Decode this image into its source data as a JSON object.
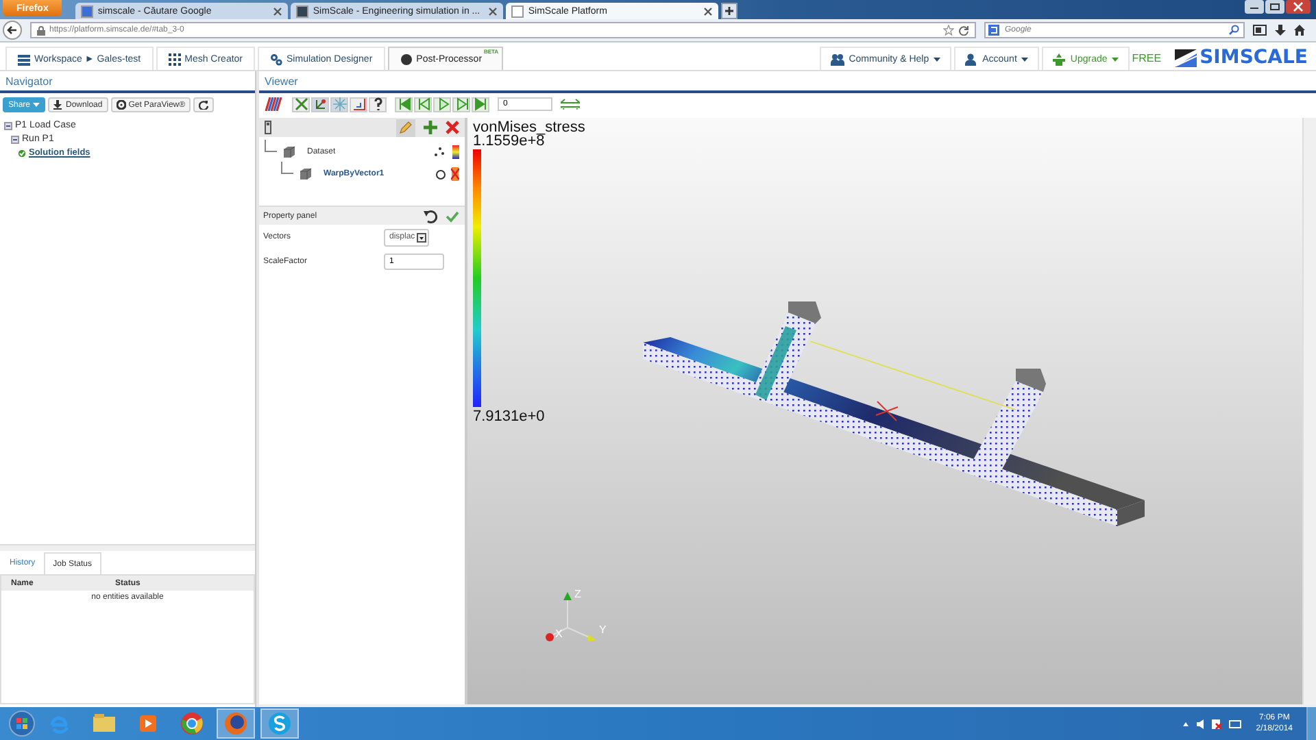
{
  "browser": {
    "menu_button": "Firefox",
    "tabs": [
      {
        "title": "simscale - Căutare Google",
        "selected": false
      },
      {
        "title": "SimScale - Engineering simulation in ...",
        "selected": false
      },
      {
        "title": "SimScale Platform",
        "selected": true
      }
    ],
    "url": "https://platform.simscale.de/#tab_3-0",
    "search_placeholder": "Google"
  },
  "app_nav": {
    "items": [
      {
        "label": "Workspace ► Gales-test",
        "selected": false
      },
      {
        "label": "Mesh Creator",
        "selected": false
      },
      {
        "label": "Simulation Designer",
        "selected": false
      },
      {
        "label": "Post-Processor",
        "badge": "BETA",
        "selected": true
      }
    ],
    "menus": [
      {
        "label": "Community & Help",
        "kind": "people"
      },
      {
        "label": "Account",
        "kind": "user"
      },
      {
        "label": "Upgrade",
        "kind": "upgrade"
      }
    ],
    "plan": "FREE",
    "logo": "SIMSCALE"
  },
  "navigator": {
    "title": "Navigator",
    "share": "Share",
    "buttons": [
      "Download",
      "Get ParaView®"
    ],
    "tree": [
      {
        "label": "P1 Load Case",
        "children": [
          {
            "label": "Run P1",
            "children": [
              {
                "label": "Solution fields",
                "kind": "link"
              }
            ]
          }
        ]
      }
    ],
    "tabs": [
      {
        "label": "History",
        "selected": false
      },
      {
        "label": "Job Status",
        "selected": true
      }
    ],
    "table": {
      "columns": [
        "Name",
        "Status"
      ],
      "empty": "no entities available"
    }
  },
  "viewer": {
    "title": "Viewer",
    "frame": "0",
    "pipeline": [
      {
        "label": "Dataset",
        "selected": false,
        "children": [
          {
            "label": "WarpByVector1",
            "selected": true
          }
        ]
      }
    ],
    "property_panel": {
      "title": "Property panel",
      "fields": [
        {
          "label": "Vectors",
          "kind": "select",
          "value": "displac"
        },
        {
          "label": "ScaleFactor",
          "kind": "text",
          "value": "1"
        }
      ]
    },
    "legend": {
      "title": "vonMises_stress",
      "max": "1.1559e+8",
      "min": "7.9131e+0"
    },
    "axes": [
      "X",
      "Y",
      "Z"
    ]
  },
  "taskbar": {
    "time": "7:06 PM",
    "date": "2/18/2014"
  }
}
